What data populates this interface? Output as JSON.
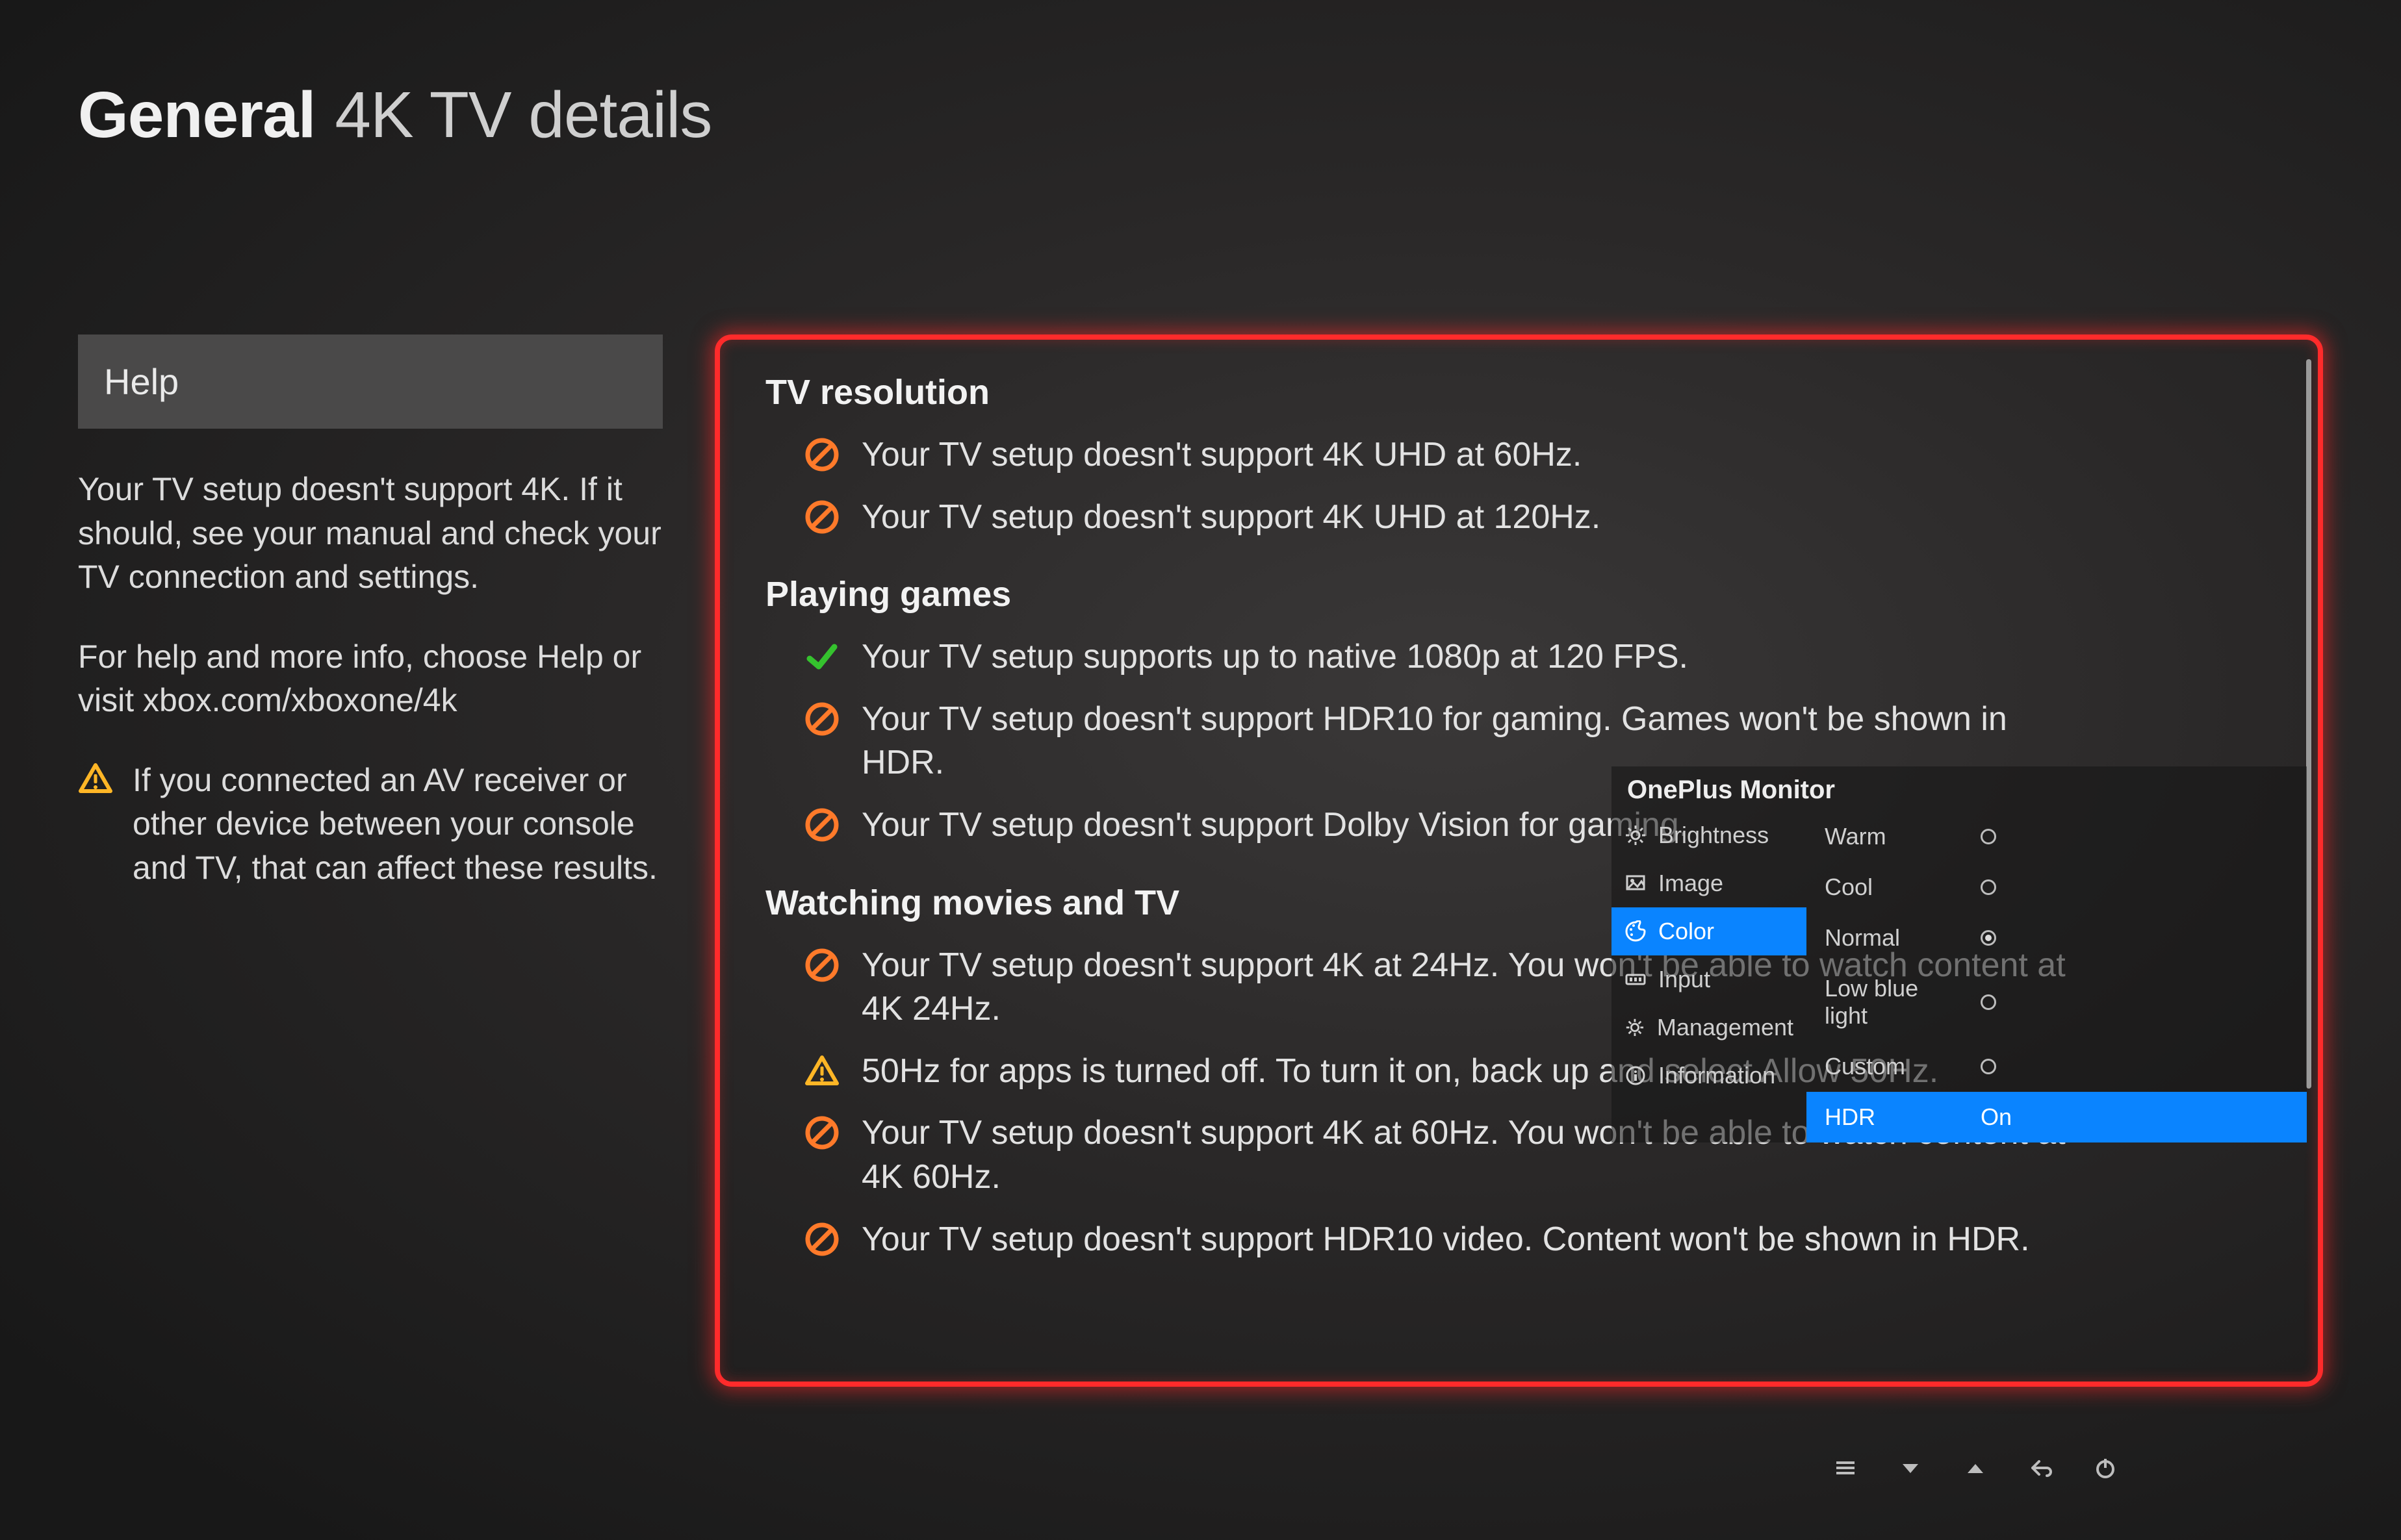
{
  "header": {
    "general": "General",
    "subtitle": "4K TV details"
  },
  "sidebar": {
    "help_label": "Help",
    "para1": "Your TV setup doesn't support 4K. If it should, see your manual and check your TV connection and settings.",
    "para2": "For help and more info, choose Help or visit xbox.com/xboxone/4k",
    "note": "If you connected an AV receiver or other device between your console and TV, that can affect these results."
  },
  "sections": [
    {
      "heading": "TV resolution",
      "items": [
        {
          "status": "no",
          "text": "Your TV setup doesn't support 4K UHD at 60Hz."
        },
        {
          "status": "no",
          "text": "Your TV setup doesn't support 4K UHD at 120Hz."
        }
      ]
    },
    {
      "heading": "Playing games",
      "items": [
        {
          "status": "check",
          "text": "Your TV setup supports up to native 1080p at 120 FPS."
        },
        {
          "status": "no",
          "text": "Your TV setup doesn't support HDR10 for gaming. Games won't be shown in HDR."
        },
        {
          "status": "no",
          "text": "Your TV setup doesn't support Dolby Vision for gaming."
        }
      ]
    },
    {
      "heading": "Watching movies and TV",
      "items": [
        {
          "status": "no",
          "text": "Your TV setup doesn't support 4K at 24Hz. You won't be able to watch content at 4K 24Hz."
        },
        {
          "status": "warn",
          "text": "50Hz for apps is turned off. To turn it on, back up and select Allow 50Hz."
        },
        {
          "status": "no",
          "text": "Your TV setup doesn't support 4K at 60Hz. You won't be able to watch content at 4K 60Hz."
        },
        {
          "status": "no",
          "text": "Your TV setup doesn't support HDR10 video. Content won't be shown in HDR."
        }
      ]
    }
  ],
  "osd": {
    "title": "OnePlus Monitor",
    "left_items": [
      {
        "icon": "brightness",
        "label": "Brightness",
        "selected": false
      },
      {
        "icon": "image",
        "label": "Image",
        "selected": false
      },
      {
        "icon": "color",
        "label": "Color",
        "selected": true
      },
      {
        "icon": "input",
        "label": "Input",
        "selected": false
      },
      {
        "icon": "management",
        "label": "Management",
        "selected": false
      },
      {
        "icon": "information",
        "label": "Information",
        "selected": false
      }
    ],
    "options": [
      {
        "label": "Warm",
        "type": "radio",
        "checked": false,
        "selected": false
      },
      {
        "label": "Cool",
        "type": "radio",
        "checked": false,
        "selected": false
      },
      {
        "label": "Normal",
        "type": "radio",
        "checked": true,
        "selected": false
      },
      {
        "label": "Low blue light",
        "type": "radio",
        "checked": false,
        "selected": false
      },
      {
        "label": "Custom",
        "type": "radio",
        "checked": false,
        "selected": false
      },
      {
        "label": "HDR",
        "type": "value",
        "value": "On",
        "selected": true
      }
    ]
  }
}
